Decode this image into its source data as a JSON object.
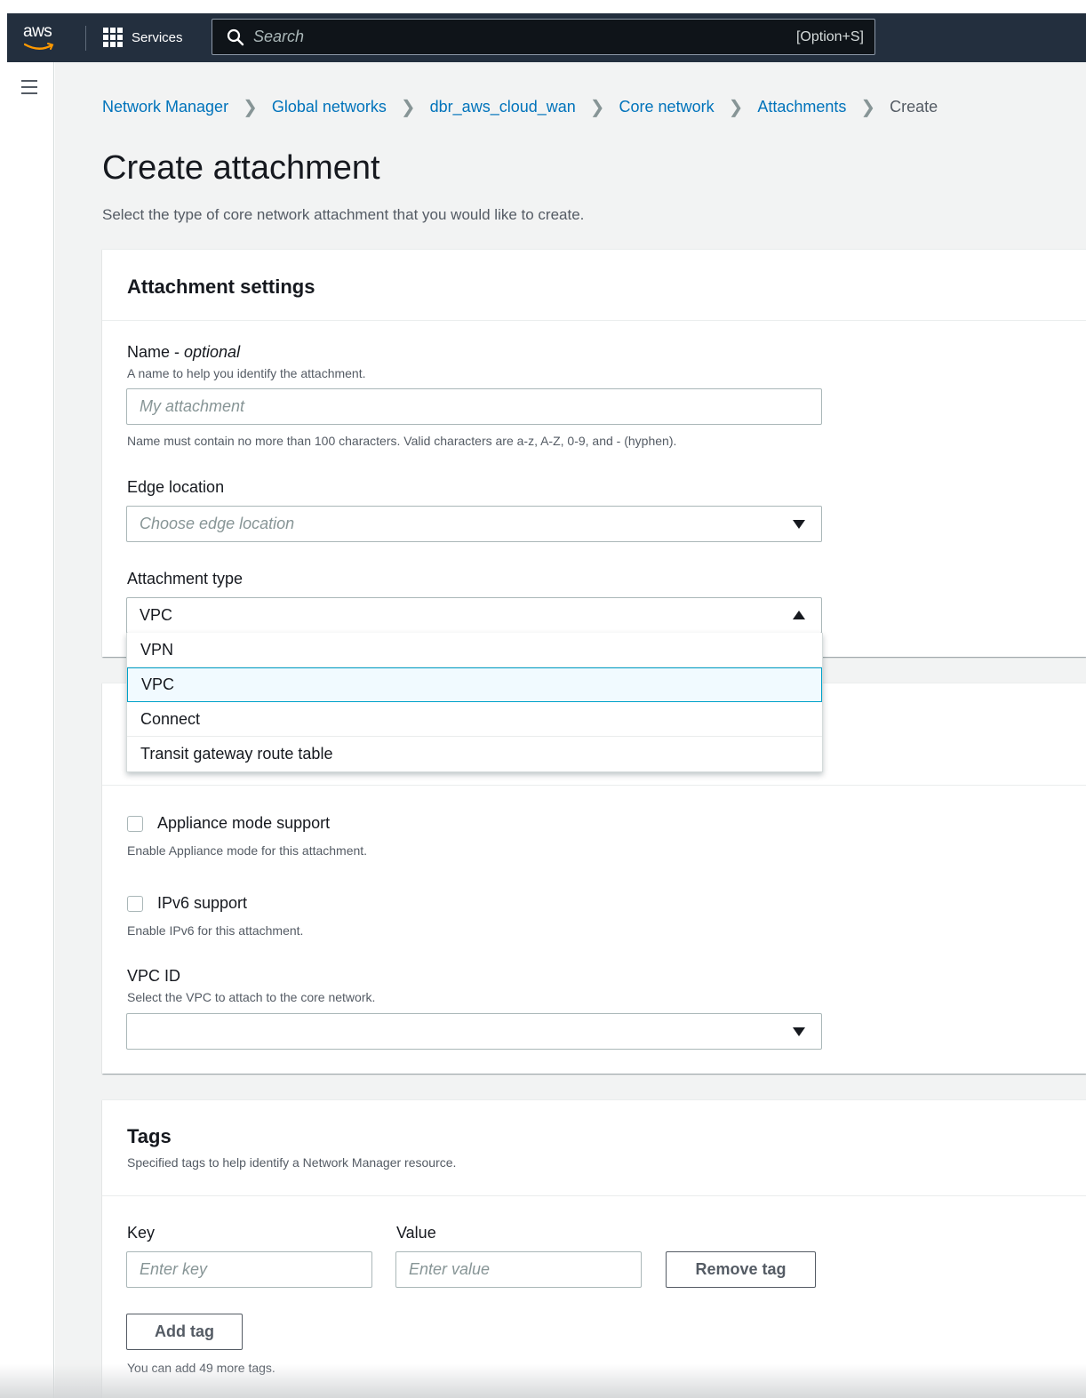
{
  "topnav": {
    "logo_text": "aws",
    "services_label": "Services",
    "search_placeholder": "Search",
    "search_shortcut": "[Option+S]"
  },
  "breadcrumb": {
    "items": [
      "Network Manager",
      "Global networks",
      "dbr_aws_cloud_wan",
      "Core network",
      "Attachments"
    ],
    "current": "Create"
  },
  "page": {
    "title": "Create attachment",
    "description": "Select the type of core network attachment that you would like to create."
  },
  "attachment_settings": {
    "heading": "Attachment settings",
    "name_label": "Name - ",
    "name_optional": "optional",
    "name_desc": "A name to help you identify the attachment.",
    "name_placeholder": "My attachment",
    "name_constraint": "Name must contain no more than 100 characters. Valid characters are a-z, A-Z, 0-9, and - (hyphen).",
    "edge_label": "Edge location",
    "edge_placeholder": "Choose edge location",
    "type_label": "Attachment type",
    "type_value": "VPC",
    "type_options": [
      "VPN",
      "VPC",
      "Connect",
      "Transit gateway route table"
    ]
  },
  "vpc_settings": {
    "appliance_label": "Appliance mode support",
    "appliance_desc": "Enable Appliance mode for this attachment.",
    "ipv6_label": "IPv6 support",
    "ipv6_desc": "Enable IPv6 for this attachment.",
    "vpcid_label": "VPC ID",
    "vpcid_desc": "Select the VPC to attach to the core network."
  },
  "tags": {
    "heading": "Tags",
    "desc": "Specified tags to help identify a Network Manager resource.",
    "key_label": "Key",
    "value_label": "Value",
    "key_placeholder": "Enter key",
    "value_placeholder": "Enter value",
    "remove_label": "Remove tag",
    "add_label": "Add tag",
    "remaining": "You can add 49 more tags."
  }
}
